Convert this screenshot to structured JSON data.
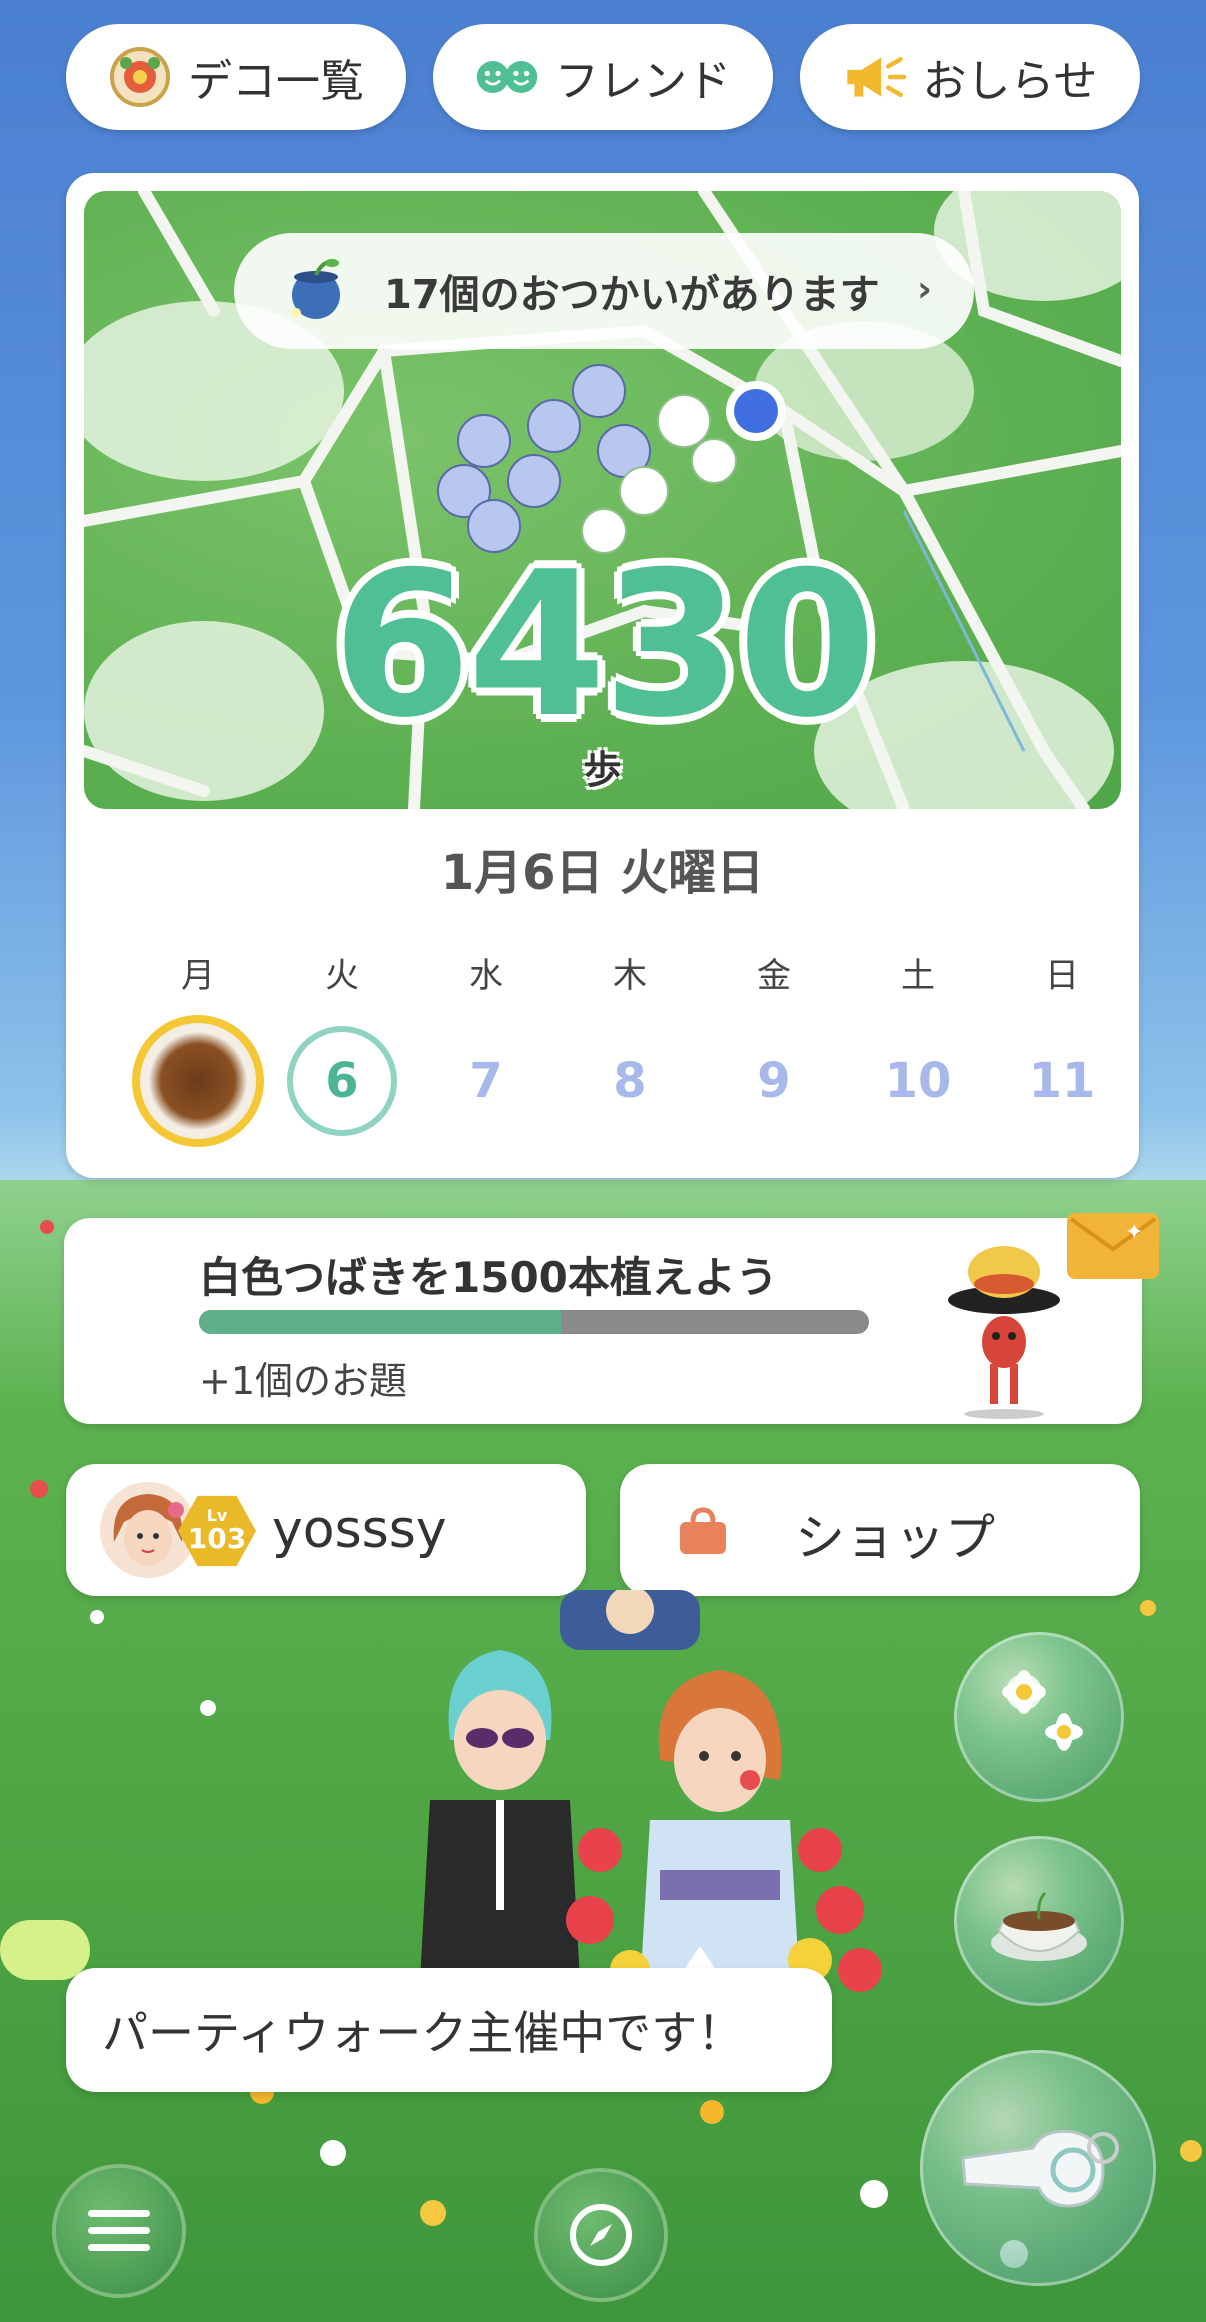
{
  "header": {
    "deco_label": "デコ一覧",
    "friends_label": "フレンド",
    "news_label": "おしらせ"
  },
  "map": {
    "errand_text": "17個のおつかいがあります",
    "errand_chevron": "›",
    "steps": "6430",
    "steps_unit": "歩"
  },
  "calendar": {
    "date_title": "1月6日 火曜日",
    "weekdays": [
      "月",
      "火",
      "水",
      "木",
      "金",
      "土",
      "日"
    ],
    "days": [
      "",
      "6",
      "7",
      "8",
      "9",
      "10",
      "11"
    ]
  },
  "mission": {
    "title": "白色つばきを1500本植えよう",
    "progress_fraction": 0.54,
    "subtitle": "+1個のお題"
  },
  "user": {
    "level_prefix": "Lv",
    "level": "103",
    "name": "yosssy"
  },
  "shop": {
    "label": "ショップ"
  },
  "party": {
    "message": "パーティウォーク主催中です！"
  },
  "icons": {
    "deco": "deco-medal-icon",
    "friends": "friends-faces-icon",
    "news": "megaphone-icon",
    "shop": "shopping-bag-icon",
    "menu": "hamburger-menu-icon",
    "compass": "compass-icon",
    "flowers": "flower-bubble-icon",
    "pot": "seedling-pot-icon",
    "whistle": "whistle-icon"
  },
  "colors": {
    "steps": "#4fbf94",
    "progress_fill": "#5fb08a",
    "progress_track": "#8a8a8a",
    "today_ring": "#8fd4c3",
    "future_days": "#a7b9ea",
    "photo_ring": "#f4c734"
  }
}
